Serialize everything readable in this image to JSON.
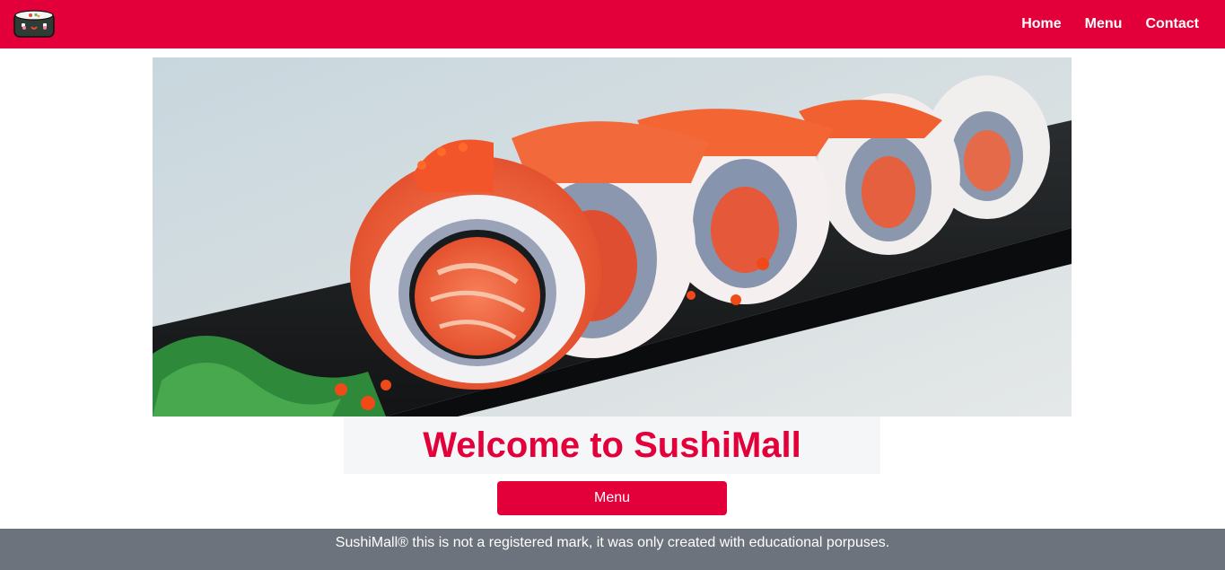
{
  "navbar": {
    "logo_icon": "sushi-roll-logo-icon",
    "links": [
      {
        "label": "Home"
      },
      {
        "label": "Menu"
      },
      {
        "label": "Contact"
      }
    ],
    "background_color": "#e3003a"
  },
  "hero": {
    "image": "sushi-rolls-photo"
  },
  "main": {
    "heading": "Welcome to SushiMall",
    "menu_button_label": "Menu"
  },
  "footer": {
    "text": "SushiMall® this is not a registered mark, it was only created with educational porpuses."
  }
}
